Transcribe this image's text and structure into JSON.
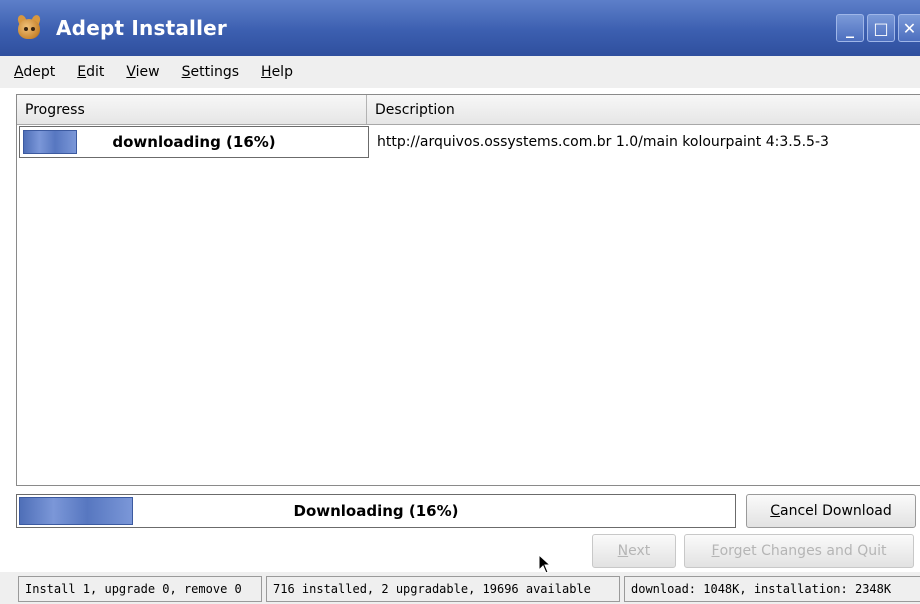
{
  "window": {
    "title": "Adept Installer"
  },
  "menu": [
    {
      "pre": "",
      "u": "A",
      "post": "dept"
    },
    {
      "pre": "",
      "u": "E",
      "post": "dit"
    },
    {
      "pre": "",
      "u": "V",
      "post": "iew"
    },
    {
      "pre": "",
      "u": "S",
      "post": "ettings"
    },
    {
      "pre": "",
      "u": "H",
      "post": "elp"
    }
  ],
  "table": {
    "headers": {
      "progress": "Progress",
      "description": "Description"
    },
    "rows": [
      {
        "progress_text": "downloading (16%)",
        "progress_fraction": 0.16,
        "description": "http://arquivos.ossystems.com.br 1.0/main kolourpaint 4:3.5.5-3"
      }
    ]
  },
  "overall_progress": {
    "text": "Downloading (16%)",
    "fraction": 0.16
  },
  "buttons": {
    "cancel": {
      "u": "C",
      "rest": "ancel Download"
    },
    "next": {
      "u": "N",
      "rest": "ext"
    },
    "forget": {
      "u": "F",
      "rest": "orget Changes and Quit"
    }
  },
  "status": {
    "changes": "Install 1, upgrade 0, remove 0",
    "counts": "716 installed, 2 upgradable, 19696 available",
    "sizes": "download: 1048K, installation: 2348K"
  },
  "colors": {
    "titlebar": "#3c5fb0",
    "progress_fill": "#5777c0"
  },
  "icons": {
    "app": "adept-mascot-icon",
    "minimize": "minimize-icon",
    "maximize": "maximize-icon",
    "close": "close-icon",
    "cursor": "mouse-pointer-icon"
  }
}
